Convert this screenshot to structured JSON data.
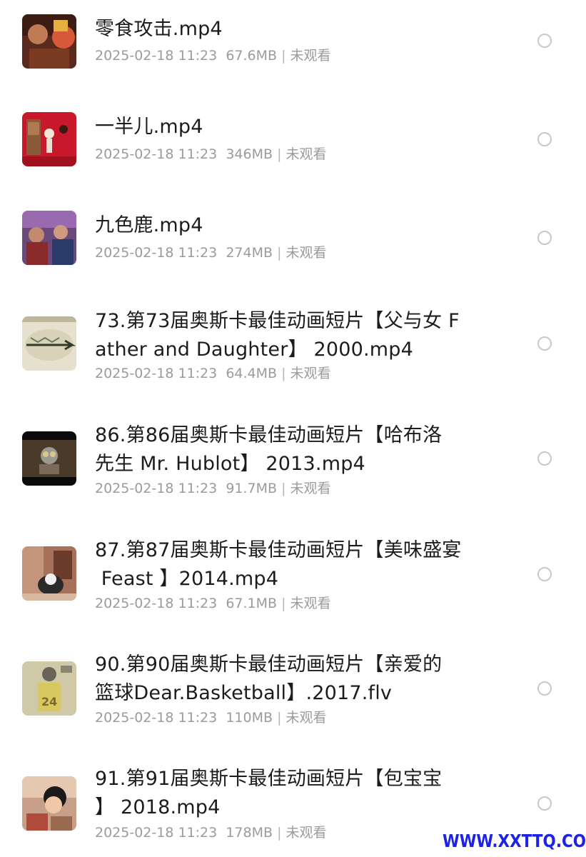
{
  "files": [
    {
      "title_lines": [
        "零食攻击.mp4"
      ],
      "date": "2025-02-18 11:23",
      "size": "67.6MB",
      "separator": "|",
      "status": "未观看",
      "thumbnail": "snack-attack-thumbnail"
    },
    {
      "title_lines": [
        "一半儿.mp4"
      ],
      "date": "2025-02-18 11:23",
      "size": "346MB",
      "separator": "|",
      "status": "未观看",
      "thumbnail": "half-thumbnail"
    },
    {
      "title_lines": [
        "九色鹿.mp4"
      ],
      "date": "2025-02-18 11:23",
      "size": "274MB",
      "separator": "|",
      "status": "未观看",
      "thumbnail": "nine-color-deer-thumbnail"
    },
    {
      "title_lines": [
        "73.第73届奥斯卡最佳动画短片【父与女 F",
        "ather and Daughter】 2000.mp4"
      ],
      "date": "2025-02-18 11:23",
      "size": "64.4MB",
      "separator": "|",
      "status": "未观看",
      "thumbnail": "father-and-daughter-thumbnail"
    },
    {
      "title_lines": [
        "86.第86届奥斯卡最佳动画短片【哈布洛",
        "先生 Mr. Hublot】 2013.mp4"
      ],
      "date": "2025-02-18 11:23",
      "size": "91.7MB",
      "separator": "|",
      "status": "未观看",
      "thumbnail": "mr-hublot-thumbnail"
    },
    {
      "title_lines": [
        "87.第87届奥斯卡最佳动画短片【美味盛宴",
        " Feast 】2014.mp4"
      ],
      "date": "2025-02-18 11:23",
      "size": "67.1MB",
      "separator": "|",
      "status": "未观看",
      "thumbnail": "feast-thumbnail"
    },
    {
      "title_lines": [
        "90.第90届奥斯卡最佳动画短片【亲爱的",
        "篮球Dear.Basketball】.2017.flv"
      ],
      "date": "2025-02-18 11:23",
      "size": "110MB",
      "separator": "|",
      "status": "未观看",
      "thumbnail": "dear-basketball-thumbnail"
    },
    {
      "title_lines": [
        "91.第91届奥斯卡最佳动画短片【包宝宝",
        "】 2018.mp4"
      ],
      "date": "2025-02-18 11:23",
      "size": "178MB",
      "separator": "|",
      "status": "未观看",
      "thumbnail": "bao-thumbnail"
    }
  ],
  "watermark": "WWW.XXTTQ.COM",
  "colors": {
    "title": "#1c1c1c",
    "meta": "#9b9b9b",
    "radio_border": "#c9c9c9",
    "watermark": "#1c22e6"
  }
}
